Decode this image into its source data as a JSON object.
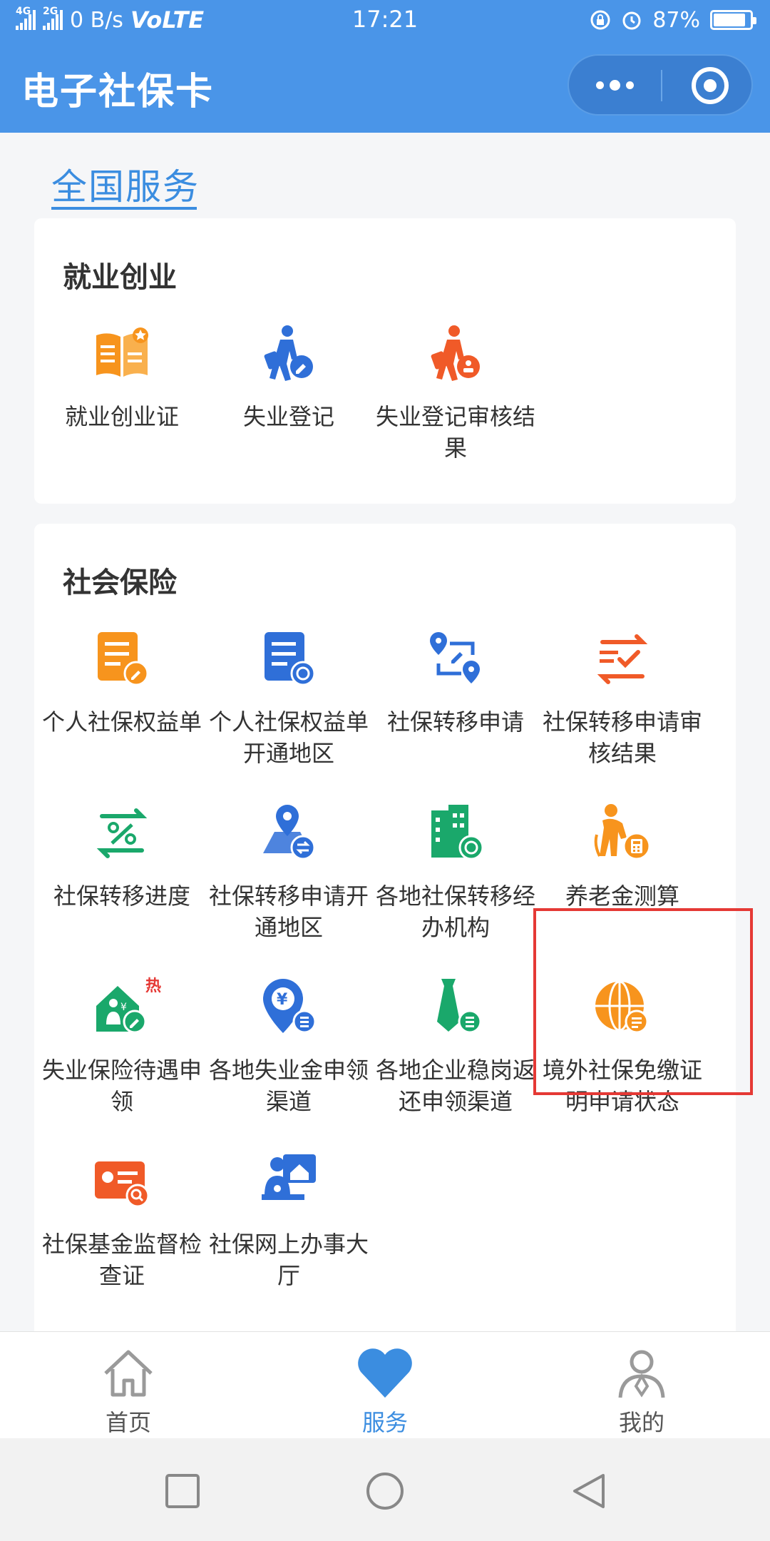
{
  "status_bar": {
    "net_left": "4G",
    "net_right": "2G",
    "speed": "0 B/s",
    "volte": "VoLTE",
    "time": "17:21",
    "battery": "87%",
    "battery_level": 0.87
  },
  "header": {
    "title": "电子社保卡",
    "more_icon": "more-dots-icon",
    "close_icon": "target-icon"
  },
  "section_tab": "全国服务",
  "categories": [
    {
      "title": "就业创业",
      "items": [
        {
          "label": "就业创业证",
          "icon": "document-star-icon",
          "color": "#f7941d"
        },
        {
          "label": "失业登记",
          "icon": "person-edit-icon",
          "color": "#2f6fd8"
        },
        {
          "label": "失业登记审核结果",
          "icon": "person-check-icon",
          "color": "#f05a28"
        }
      ]
    },
    {
      "title": "社会保险",
      "items": [
        {
          "label": "个人社保权益单",
          "icon": "list-edit-icon",
          "color": "#f7941d"
        },
        {
          "label": "个人社保权益单开通地区",
          "icon": "list-globe-icon",
          "color": "#2f6fd8"
        },
        {
          "label": "社保转移申请",
          "icon": "transfer-location-icon",
          "color": "#2f6fd8"
        },
        {
          "label": "社保转移申请审核结果",
          "icon": "transfer-check-icon",
          "color": "#f05a28"
        },
        {
          "label": "社保转移进度",
          "icon": "transfer-percent-icon",
          "color": "#1aa86b"
        },
        {
          "label": "社保转移申请开通地区",
          "icon": "map-pin-exchange-icon",
          "color": "#2f6fd8"
        },
        {
          "label": "各地社保转移经办机构",
          "icon": "building-globe-icon",
          "color": "#1aa86b"
        },
        {
          "label": "养老金测算",
          "icon": "elderly-calculator-icon",
          "color": "#f7941d"
        },
        {
          "label": "失业保险待遇申领",
          "icon": "house-person-hot-icon",
          "color": "#1aa86b",
          "badge": "热"
        },
        {
          "label": "各地失业金申领渠道",
          "icon": "yuan-pin-icon",
          "color": "#2f6fd8"
        },
        {
          "label": "各地企业稳岗返还申领渠道",
          "icon": "tie-icon",
          "color": "#1aa86b"
        },
        {
          "label": "境外社保免缴证明申请状态",
          "icon": "globe-doc-icon",
          "color": "#f7941d"
        },
        {
          "label": "社保基金监督检查证",
          "icon": "card-search-icon",
          "color": "#f05a28"
        },
        {
          "label": "社保网上办事大厅",
          "icon": "service-hall-icon",
          "color": "#2f6fd8"
        }
      ]
    }
  ],
  "tabbar": [
    {
      "label": "首页",
      "icon": "home-icon"
    },
    {
      "label": "服务",
      "icon": "heart-icon",
      "active": true
    },
    {
      "label": "我的",
      "icon": "profile-icon"
    }
  ],
  "colors": {
    "primary": "#4a95e8",
    "accent": "#3b8de0",
    "highlight": "#e53935"
  }
}
